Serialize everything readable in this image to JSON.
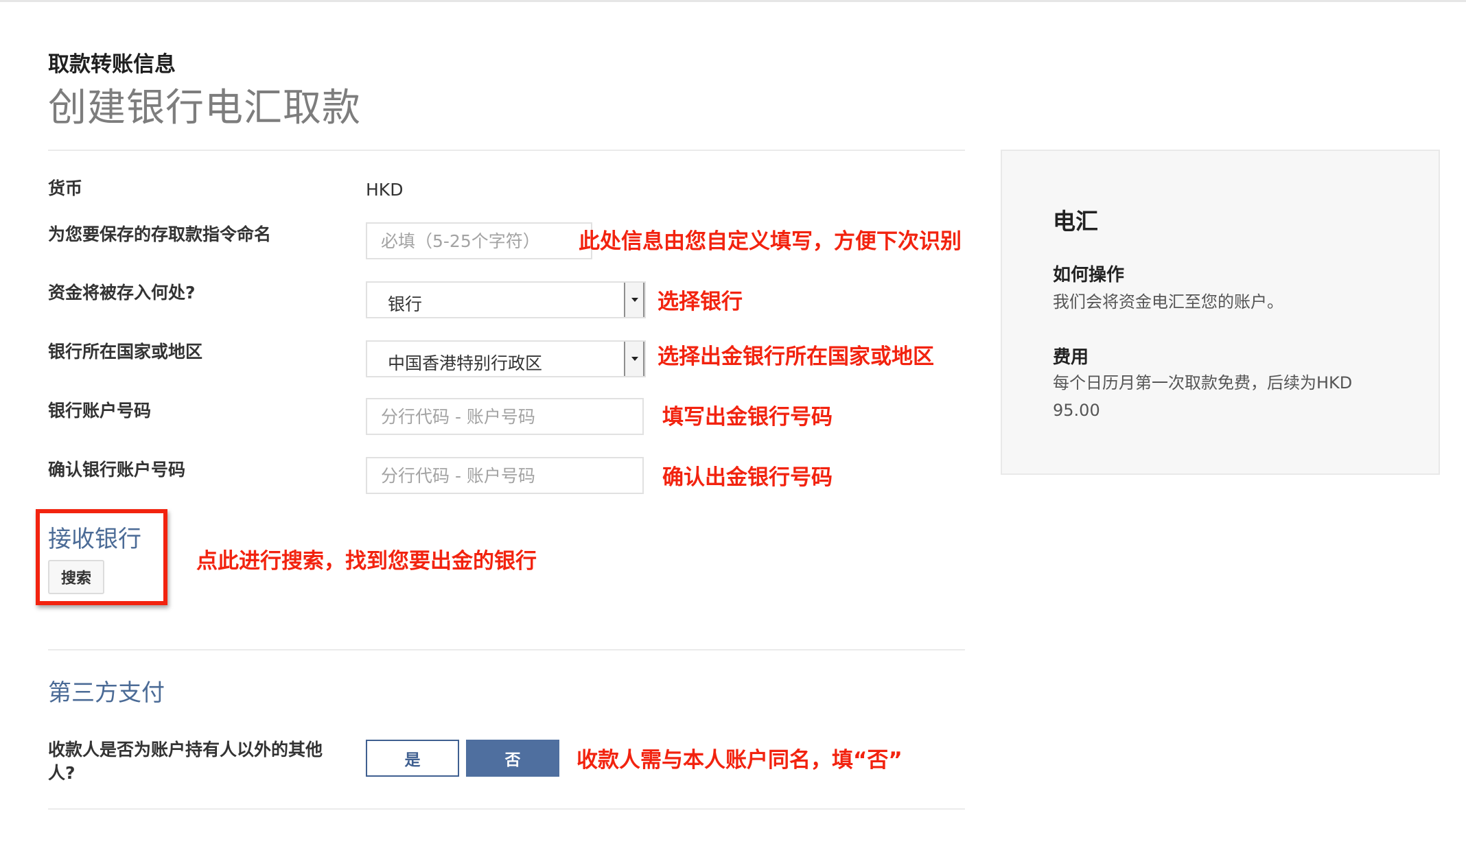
{
  "header": {
    "subtitle": "取款转账信息",
    "title": "创建银行电汇取款"
  },
  "form": {
    "currency": {
      "label": "货币",
      "value": "HKD"
    },
    "instruction_name": {
      "label": "为您要保存的存取款指令命名",
      "placeholder": "必填（5-25个字符）"
    },
    "destination": {
      "label": "资金将被存入何处?",
      "selected": "银行"
    },
    "bank_country": {
      "label": "银行所在国家或地区",
      "selected": "中国香港特别行政区"
    },
    "account_number": {
      "label": "银行账户号码",
      "placeholder": "分行代码 - 账户号码"
    },
    "confirm_account_number": {
      "label": "确认银行账户号码",
      "placeholder": "分行代码 - 账户号码"
    },
    "receiving_bank": {
      "label": "接收银行",
      "search_label": "搜索"
    },
    "third_party": {
      "section_title": "第三方支付",
      "question": "收款人是否为账户持有人以外的其他人?",
      "yes_label": "是",
      "no_label": "否",
      "selected": "否"
    }
  },
  "annotations": {
    "instruction_name": "此处信息由您自定义填写，方便下次识别",
    "destination": "选择银行",
    "bank_country": "选择出金银行所在国家或地区",
    "account_number": "填写出金银行号码",
    "confirm_account_number": "确认出金银行号码",
    "receiving_bank": "点此进行搜索，找到您要出金的银行",
    "third_party": "收款人需与本人账户同名，填“否”"
  },
  "side_panel": {
    "title": "电汇",
    "how_heading": "如何操作",
    "how_text": "我们会将资金电汇至您的账户。",
    "fee_heading": "费用",
    "fee_text": "每个日历月第一次取款免费，后续为HKD 95.00"
  },
  "colors": {
    "annotation_red": "#f2230f",
    "primary_blue": "#4f6f9f",
    "link_blue": "#4b6b96"
  }
}
